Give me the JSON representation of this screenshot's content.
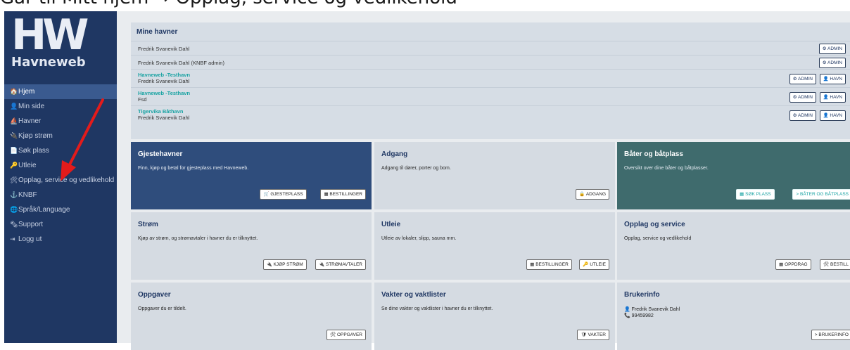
{
  "caption": "Går til Mitt hjem → Opplag, service og vedlikehold",
  "sidebar": {
    "logo_text": "HW",
    "brand_text": "Havneweb",
    "items": [
      {
        "label": "Hjem",
        "icon": "home-icon",
        "glyph": "🏠"
      },
      {
        "label": "Min side",
        "icon": "user-icon",
        "glyph": "👤"
      },
      {
        "label": "Havner",
        "icon": "harbor-icon",
        "glyph": "⛵"
      },
      {
        "label": "Kjøp strøm",
        "icon": "plug-icon",
        "glyph": "🔌"
      },
      {
        "label": "Søk plass",
        "icon": "document-icon",
        "glyph": "📄"
      },
      {
        "label": "Utleie",
        "icon": "key-icon",
        "glyph": "🔑"
      },
      {
        "label": "Opplag, service og vedlikehold",
        "icon": "tools-icon",
        "glyph": "🛠"
      },
      {
        "label": "KNBF",
        "icon": "anchor-icon",
        "glyph": "⚓"
      },
      {
        "label": "Språk/Language",
        "icon": "globe-icon",
        "glyph": "🌐"
      },
      {
        "label": "Support",
        "icon": "support-icon",
        "glyph": "🗞"
      },
      {
        "label": "Logg ut",
        "icon": "logout-icon",
        "glyph": "⇥"
      }
    ]
  },
  "havner": {
    "title": "Mine havner",
    "rows": [
      {
        "name": "Fredrik Svanevik Dahl",
        "link": "",
        "buttons": [
          "ADMIN"
        ]
      },
      {
        "name": "Fredrik Svanevik Dahl (KNBF admin)",
        "link": "",
        "buttons": [
          "ADMIN"
        ]
      },
      {
        "name": "Fredrik Svanevik Dahl",
        "link": "Havneweb -Testhavn",
        "buttons": [
          "ADMIN",
          "HAVN"
        ]
      },
      {
        "name": "Fsd",
        "link": "Havneweb -Testhavn",
        "buttons": [
          "ADMIN",
          "HAVN"
        ]
      },
      {
        "name": "Fredrik Svanevik Dahl",
        "link": "Tigervika Båthavn",
        "buttons": [
          "ADMIN",
          "HAVN"
        ]
      }
    ]
  },
  "tiles": [
    {
      "title": "Gjestehavner",
      "desc": "Finn, kjøp og betal for gjesteplass med Havneweb.",
      "buttons": [
        "GJESTEPLASS",
        "BESTILLINGER"
      ],
      "style": "dark"
    },
    {
      "title": "Adgang",
      "desc": "Adgang til dører, porter og bom.",
      "buttons": [
        "ADGANG"
      ],
      "style": ""
    },
    {
      "title": "Båter og båtplass",
      "desc": "Oversikt over dine båter og båtplasser.",
      "buttons": [
        "SØK PLASS",
        "BÅTER OG BÅTPLASS"
      ],
      "style": "teal"
    },
    {
      "title": "Strøm",
      "desc": "Kjøp av strøm, og strømavtaler i havner du er tilknyttet.",
      "buttons": [
        "KJØP STRØM",
        "STRØMAVTALER"
      ],
      "style": ""
    },
    {
      "title": "Utleie",
      "desc": "Utleie av lokaler, slipp, sauna mm.",
      "buttons": [
        "BESTILLINGER",
        "UTLEIE"
      ],
      "style": ""
    },
    {
      "title": "Opplag og service",
      "desc": "Opplag, service og vedlikehold",
      "buttons": [
        "OPPDRAG",
        "BESTILL"
      ],
      "style": ""
    },
    {
      "title": "Oppgaver",
      "desc": "Oppgaver du er tildelt.",
      "buttons": [
        "OPPGAVER"
      ],
      "style": ""
    },
    {
      "title": "Vakter og vaktlister",
      "desc": "Se dine vakter og vaktlister i havner du er tilknyttet.",
      "buttons": [
        "VAKTER"
      ],
      "style": ""
    },
    {
      "title": "Brukerinfo",
      "desc": "",
      "buttons": [
        "BRUKERINFO"
      ],
      "style": ""
    }
  ],
  "userinfo": {
    "name": "Fredrik Svanevik Dahl",
    "phone": "99459982"
  },
  "annotation": {
    "color": "#e31b1b"
  }
}
